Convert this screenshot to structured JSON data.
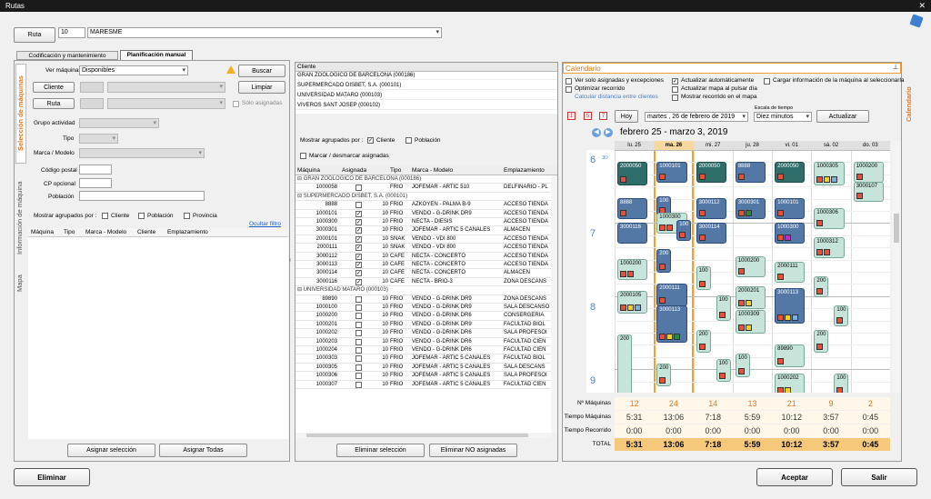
{
  "window": {
    "title": "Rutas",
    "close": "✕"
  },
  "header": {
    "ruta_button": "Ruta",
    "ruta_number": "10",
    "ruta_name": "MARESME"
  },
  "tabs": [
    "Codificación y mantenimiento",
    "Planificación manual"
  ],
  "left": {
    "side_tabs": [
      "Selección de máquinas",
      "Información de máquina",
      "Mapa"
    ],
    "ver_label": "Ver máquinas",
    "ver_value": "Disponibles",
    "buscar": "Buscar",
    "limpiar": "Limpiar",
    "cliente_btn": "Cliente",
    "ruta_btn": "Ruta",
    "solo_asignadas": "Sólo asignadas",
    "grupo": "Grupo actividad",
    "tipo": "Tipo",
    "marca": "Marca / Modelo",
    "cp": "Código postal",
    "cp_opc": "CP opcional",
    "poblacion": "Población",
    "agrupados": "Mostrar agrupados por :",
    "opt_cliente": "Cliente",
    "opt_poblacion": "Población",
    "opt_provincia": "Provincia",
    "ocultar": "Ocultar filtro",
    "cols": [
      "Máquina",
      "Tipo",
      "Marca - Modelo",
      "Cliente",
      "Emplazamiento"
    ],
    "asignar_sel": "Asignar selección",
    "asignar_todas": "Asignar Todas"
  },
  "middle": {
    "cliente_header": "Cliente",
    "clientes": [
      "GRAN ZOOLOGICO DE BARCELONA (000186)",
      "SUPERMERCADO DISBET, S.A. (000101)",
      "UNIVERSIDAD MATARO (000103)",
      "VIVEROS SANT JOSEP (000102)"
    ],
    "agrupados": "Mostrar agrupados por :",
    "opt_cliente": "Cliente",
    "opt_poblacion": "Población",
    "marcar": "Marcar / desmarcar asignadas",
    "cols": [
      "Máquina",
      "Asignada",
      "",
      "Tipo",
      "Marca - Modelo",
      "Emplazamiento"
    ],
    "rows": [
      {
        "g": "GRAN ZOOLOGICO DE BARCELONA (000186)"
      },
      {
        "m": "1000058",
        "a": false,
        "n": "",
        "t": "FRIO",
        "mm": "JOFEMAR - ARTIC 510",
        "e": "DELFINARIO - PL"
      },
      {
        "g": "SUPERMERCADO DISBET, S.A. (000101)"
      },
      {
        "m": "8888",
        "a": false,
        "n": "10",
        "t": "FRIO",
        "mm": "AZKOYEN - PALMA B-9",
        "e": "ACCESO TIENDA"
      },
      {
        "m": "1000101",
        "a": true,
        "n": "10",
        "t": "FRIO",
        "mm": "VENDO - G-DRINK DR9",
        "e": "ACCESO TIENDA"
      },
      {
        "m": "1000300",
        "a": true,
        "n": "10",
        "t": "FRIO",
        "mm": "NECTA - DIESIS",
        "e": "ACCESO TIENDA"
      },
      {
        "m": "3000301",
        "a": true,
        "n": "10",
        "t": "FRIO",
        "mm": "JOFEMAR - ARTIC 5 CANALES",
        "e": "ALMACEN"
      },
      {
        "m": "2000101",
        "a": true,
        "n": "10",
        "t": "SNAK",
        "mm": "VENDO - VDI 800",
        "e": "ACCESO TIENDA"
      },
      {
        "m": "2000111",
        "a": true,
        "n": "10",
        "t": "SNAK",
        "mm": "VENDO - VDI 800",
        "e": "ACCESO TIENDA"
      },
      {
        "m": "3000112",
        "a": true,
        "n": "10",
        "t": "CAFE",
        "mm": "NECTA - CONCERTO",
        "e": "ACCESO TIENDA"
      },
      {
        "m": "3000113",
        "a": true,
        "n": "10",
        "t": "CAFE",
        "mm": "NECTA - CONCERTO",
        "e": "ACCESO TIENDA"
      },
      {
        "m": "3000114",
        "a": true,
        "n": "10",
        "t": "CAFE",
        "mm": "NECTA - CONCERTO",
        "e": "ALMACEN"
      },
      {
        "m": "3000116",
        "a": true,
        "n": "10",
        "t": "CAFE",
        "mm": "NECTA - BRIO-3",
        "e": "ZONA DESCANS"
      },
      {
        "g": "UNIVERSIDAD MATARO (000103)"
      },
      {
        "m": "89890",
        "a": false,
        "n": "10",
        "t": "FRIO",
        "mm": "VENDO - G-DRINK DR9",
        "e": "ZONA DESCANS"
      },
      {
        "m": "1000100",
        "a": false,
        "n": "10",
        "t": "FRIO",
        "mm": "VENDO - G-DRINK DR9",
        "e": "SALA DESCANSO"
      },
      {
        "m": "1000200",
        "a": false,
        "n": "10",
        "t": "FRIO",
        "mm": "VENDO - G-DRINK DR6",
        "e": "CONSERGERIA"
      },
      {
        "m": "1000201",
        "a": false,
        "n": "10",
        "t": "FRIO",
        "mm": "VENDO - G-DRINK DR9",
        "e": "FACULTAD BIOL"
      },
      {
        "m": "1000202",
        "a": false,
        "n": "10",
        "t": "FRIO",
        "mm": "VENDO - G-DRINK DR6",
        "e": "SALA PROFESOI"
      },
      {
        "m": "1000203",
        "a": false,
        "n": "10",
        "t": "FRIO",
        "mm": "VENDO - G-DRINK DR6",
        "e": "FACULTAD CIEN"
      },
      {
        "m": "1000204",
        "a": false,
        "n": "10",
        "t": "FRIO",
        "mm": "VENDO - G-DRINK DR6",
        "e": "FACULTAD CIEN"
      },
      {
        "m": "1000303",
        "a": false,
        "n": "10",
        "t": "FRIO",
        "mm": "JOFEMAR - ARTIC 5 CANALES",
        "e": "FACULTAD BIOL"
      },
      {
        "m": "1000305",
        "a": false,
        "n": "10",
        "t": "FRIO",
        "mm": "JOFEMAR - ARTIC 5 CANALES",
        "e": "SALA DESCANS"
      },
      {
        "m": "1000306",
        "a": false,
        "n": "10",
        "t": "FRIO",
        "mm": "JOFEMAR - ARTIC 5 CANALES",
        "e": "SALA PROFESOI"
      },
      {
        "m": "1000307",
        "a": false,
        "n": "10",
        "t": "FRIO",
        "mm": "JOFEMAR - ARTIC 5 CANALES",
        "e": "FACULTAD CIEN"
      }
    ],
    "eliminar_sel": "Eliminar selección",
    "eliminar_no": "Eliminar NO asignadas"
  },
  "calendar": {
    "title": "Calendario",
    "side_tab": "Calendario",
    "opts": [
      "Ver solo asignadas y excepciones",
      "Optimizar recorrido",
      "Calcular distancia entre clientes",
      "Actualizar automáticamente",
      "Actualizar mapa al pulsar día",
      "Mostrar recorrido en el mapa",
      "Cargar información de la máquina al seleccionarla"
    ],
    "hoy": "Hoy",
    "fecha": "martes , 26 de febrero de 2019",
    "escala_label": "Escala de tiempo",
    "escala": "Diez minutos",
    "actualizar": "Actualizar",
    "icons": [
      "1",
      "5",
      "7"
    ],
    "range": "febrero 25 - marzo 3, 2019",
    "days": [
      "lu. 25",
      "ma. 26",
      "mi. 27",
      "ju. 28",
      "vi. 01",
      "sá. 02",
      "do. 03"
    ],
    "hours": [
      "6",
      "7",
      "8",
      "9"
    ],
    "minute_label": "30",
    "events": [
      {
        "d": 0,
        "t": 0.05,
        "h": 0.08,
        "c": "t",
        "l": "2000050",
        "sq": [
          "#e8503a"
        ]
      },
      {
        "d": 0,
        "t": 0.2,
        "h": 0.07,
        "c": "b",
        "l": "8888",
        "sq": [
          "#e8503a"
        ]
      },
      {
        "d": 0,
        "t": 0.3,
        "h": 0.07,
        "c": "b",
        "l": "3000116",
        "sq": []
      },
      {
        "d": 0,
        "t": 0.45,
        "h": 0.07,
        "c": "g",
        "l": "1000200",
        "sq": [
          "#e8503a",
          "#e8503a"
        ]
      },
      {
        "d": 0,
        "t": 0.58,
        "h": 0.08,
        "c": "g",
        "l": "2000105",
        "sq": [
          "#e8503a",
          "#f0d020",
          "#7ab0e0"
        ]
      },
      {
        "d": 0,
        "t": 0.76,
        "h": 0.3,
        "c": "g",
        "l": "200",
        "sq": [
          "#e8503a"
        ],
        "narrow": true
      },
      {
        "d": 1,
        "t": 0.05,
        "h": 0.07,
        "c": "b",
        "l": "1000101",
        "sq": [
          "#e8503a"
        ]
      },
      {
        "d": 1,
        "t": 0.19,
        "h": 0.07,
        "c": "b",
        "l": "100",
        "sq": [
          "#e8503a"
        ],
        "narrow": true
      },
      {
        "d": 1,
        "t": 0.26,
        "h": 0.07,
        "c": "g",
        "l": "1000300",
        "sq": [
          "#e8503a",
          "#e8503a"
        ]
      },
      {
        "d": 1,
        "t": 0.29,
        "h": 0.07,
        "c": "b",
        "l": "100",
        "sq": [
          "#e8503a"
        ],
        "narrow": true,
        "off": 1
      },
      {
        "d": 1,
        "t": 0.41,
        "h": 0.08,
        "c": "b",
        "l": "200",
        "sq": [
          "#e8503a"
        ],
        "narrow": true
      },
      {
        "d": 1,
        "t": 0.55,
        "h": 0.08,
        "c": "b",
        "l": "2000111",
        "sq": [
          "#e8503a"
        ]
      },
      {
        "d": 1,
        "t": 0.64,
        "h": 0.14,
        "c": "b",
        "l": "3000113",
        "sq": [
          "#e8503a",
          "#f0d020",
          "#2a8a3a"
        ]
      },
      {
        "d": 1,
        "t": 0.88,
        "h": 0.08,
        "c": "g",
        "l": "200",
        "sq": [
          "#e8503a"
        ],
        "narrow": true
      },
      {
        "d": 2,
        "t": 0.05,
        "h": 0.07,
        "c": "t",
        "l": "2000050",
        "sq": [
          "#e8503a"
        ]
      },
      {
        "d": 2,
        "t": 0.2,
        "h": 0.07,
        "c": "b",
        "l": "3000112",
        "sq": [
          "#e8503a"
        ]
      },
      {
        "d": 2,
        "t": 0.3,
        "h": 0.07,
        "c": "b",
        "l": "3000114",
        "sq": [
          "#e8503a"
        ]
      },
      {
        "d": 2,
        "t": 0.48,
        "h": 0.08,
        "c": "g",
        "l": "100",
        "sq": [
          "#e8503a"
        ],
        "narrow": true
      },
      {
        "d": 2,
        "t": 0.6,
        "h": 0.09,
        "c": "g",
        "l": "100",
        "sq": [
          "#e8503a"
        ],
        "narrow": true,
        "off": 1
      },
      {
        "d": 2,
        "t": 0.74,
        "h": 0.08,
        "c": "g",
        "l": "200",
        "sq": [
          "#e8503a"
        ],
        "narrow": true
      },
      {
        "d": 2,
        "t": 0.86,
        "h": 0.08,
        "c": "g",
        "l": "100",
        "sq": [
          "#e8503a"
        ],
        "narrow": true,
        "off": 1
      },
      {
        "d": 3,
        "t": 0.05,
        "h": 0.07,
        "c": "b",
        "l": "8888",
        "sq": [
          "#e8503a"
        ]
      },
      {
        "d": 3,
        "t": 0.2,
        "h": 0.07,
        "c": "b",
        "l": "3000301",
        "sq": [
          "#e8503a",
          "#2a8a3a"
        ]
      },
      {
        "d": 3,
        "t": 0.44,
        "h": 0.07,
        "c": "g",
        "l": "1000200",
        "sq": [
          "#e8503a"
        ]
      },
      {
        "d": 3,
        "t": 0.56,
        "h": 0.08,
        "c": "g",
        "l": "2000201",
        "sq": [
          "#e8503a",
          "#f0d020"
        ]
      },
      {
        "d": 3,
        "t": 0.66,
        "h": 0.08,
        "c": "g",
        "l": "1000309",
        "sq": [
          "#e8503a",
          "#f0d020"
        ]
      },
      {
        "d": 3,
        "t": 0.84,
        "h": 0.08,
        "c": "g",
        "l": "100",
        "sq": [
          "#e8503a"
        ],
        "narrow": true
      },
      {
        "d": 4,
        "t": 0.05,
        "h": 0.07,
        "c": "t",
        "l": "2000050",
        "sq": [
          "#e8503a"
        ]
      },
      {
        "d": 4,
        "t": 0.2,
        "h": 0.07,
        "c": "b",
        "l": "1000101",
        "sq": [
          "#e8503a"
        ]
      },
      {
        "d": 4,
        "t": 0.3,
        "h": 0.07,
        "c": "b",
        "l": "1000300",
        "sq": [
          "#e8503a",
          "#c030c0"
        ]
      },
      {
        "d": 4,
        "t": 0.46,
        "h": 0.07,
        "c": "g",
        "l": "2000111",
        "sq": [
          "#e8503a"
        ]
      },
      {
        "d": 4,
        "t": 0.57,
        "h": 0.13,
        "c": "b",
        "l": "3000113",
        "sq": [
          "#e8503a",
          "#f0d020",
          "#7ab0e0"
        ]
      },
      {
        "d": 4,
        "t": 0.8,
        "h": 0.08,
        "c": "g",
        "l": "89890",
        "sq": [
          "#e8503a"
        ]
      },
      {
        "d": 4,
        "t": 0.92,
        "h": 0.08,
        "c": "g",
        "l": "1000202",
        "sq": [
          "#e8503a",
          "#f0d020"
        ]
      },
      {
        "d": 5,
        "t": 0.05,
        "h": 0.08,
        "c": "g",
        "l": "1000305",
        "sq": [
          "#e8503a",
          "#f0d020",
          "#7ab0e0"
        ]
      },
      {
        "d": 5,
        "t": 0.24,
        "h": 0.07,
        "c": "g",
        "l": "1000306",
        "sq": [
          "#e8503a"
        ]
      },
      {
        "d": 5,
        "t": 0.36,
        "h": 0.07,
        "c": "g",
        "l": "1000312",
        "sq": [
          "#e8503a",
          "#e8503a"
        ]
      },
      {
        "d": 5,
        "t": 0.52,
        "h": 0.07,
        "c": "g",
        "l": "200",
        "sq": [
          "#e8503a"
        ],
        "narrow": true
      },
      {
        "d": 5,
        "t": 0.64,
        "h": 0.07,
        "c": "g",
        "l": "100",
        "sq": [
          "#e8503a"
        ],
        "narrow": true,
        "off": 1
      },
      {
        "d": 5,
        "t": 0.74,
        "h": 0.08,
        "c": "g",
        "l": "200",
        "sq": [
          "#e8503a"
        ],
        "narrow": true
      },
      {
        "d": 5,
        "t": 0.92,
        "h": 0.08,
        "c": "g",
        "l": "100",
        "sq": [
          "#e8503a"
        ],
        "narrow": true,
        "off": 1
      },
      {
        "d": 6,
        "t": 0.05,
        "h": 0.07,
        "c": "g",
        "l": "1000200",
        "sq": [
          "#e8503a"
        ]
      },
      {
        "d": 6,
        "t": 0.13,
        "h": 0.07,
        "c": "g",
        "l": "3000107",
        "sq": [
          "#e8503a"
        ]
      }
    ],
    "totals": {
      "rows": [
        "Nº Máquinas",
        "Tiempo Máquinas",
        "Tiempo Recorrido",
        "TOTAL"
      ],
      "values": [
        [
          "12",
          "24",
          "14",
          "13",
          "21",
          "9",
          "2"
        ],
        [
          "5:31",
          "13:06",
          "7:18",
          "5:59",
          "10:12",
          "3:57",
          "0:45"
        ],
        [
          "0:00",
          "0:00",
          "0:00",
          "0:00",
          "0:00",
          "0:00",
          "0:00"
        ],
        [
          "5:31",
          "13:06",
          "7:18",
          "5:59",
          "10:12",
          "3:57",
          "0:45"
        ]
      ]
    }
  },
  "footer": {
    "eliminar": "Eliminar",
    "aceptar": "Aceptar",
    "salir": "Salir"
  },
  "colors": {
    "accent": "#f0a030",
    "today": "#f7d9a0",
    "total_bg": "#f6c97a"
  }
}
